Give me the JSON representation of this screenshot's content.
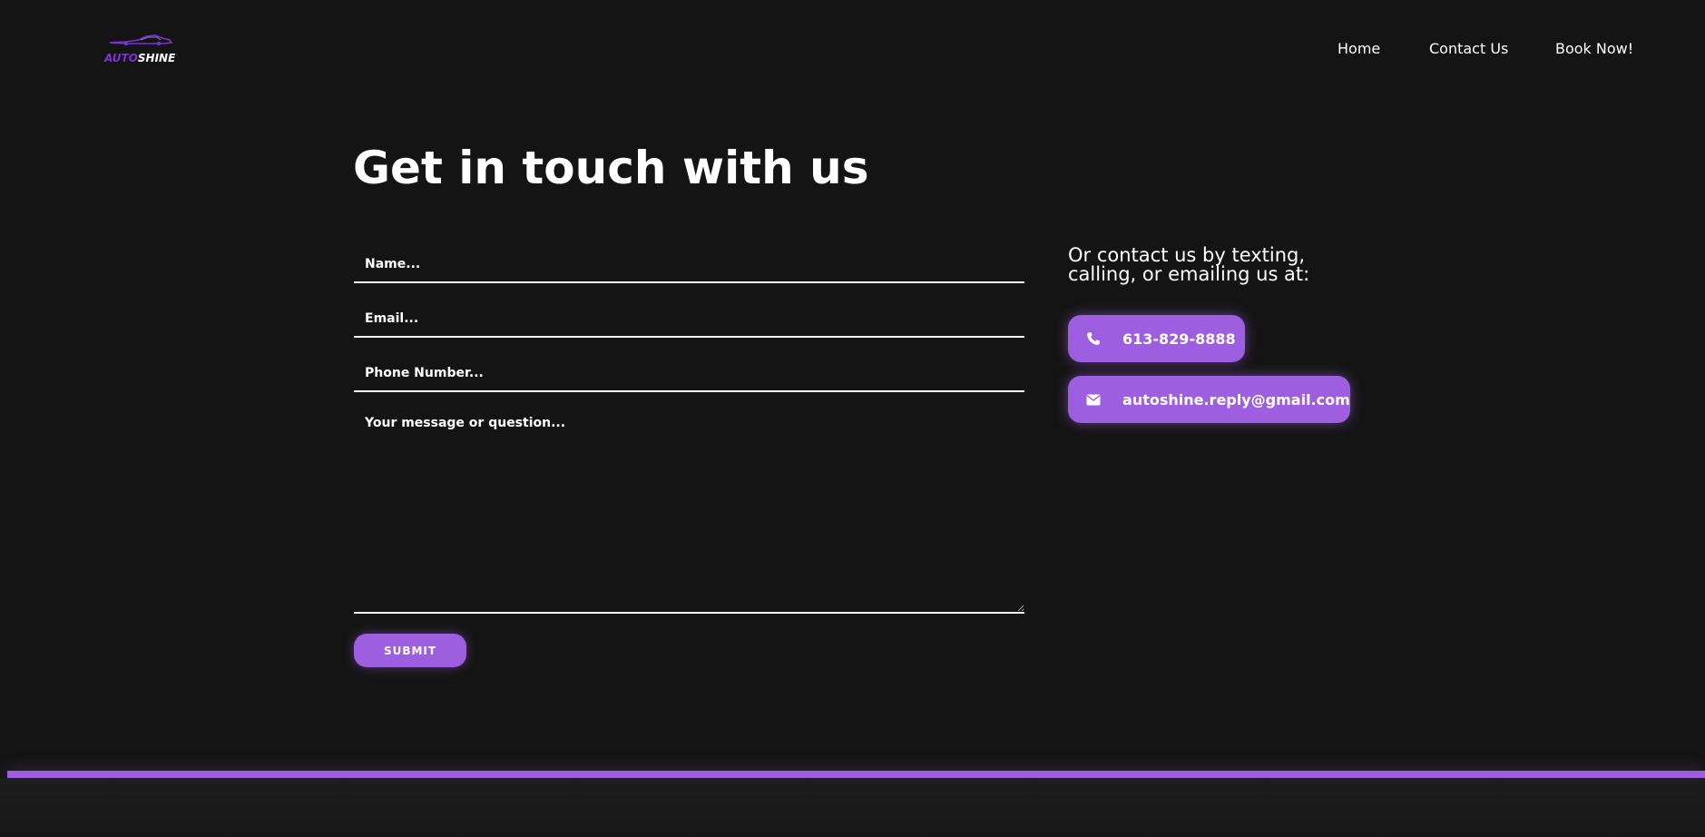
{
  "brand": {
    "part1": "AUTO",
    "part2": "SHINE",
    "accent_color": "#7a32d6"
  },
  "nav": {
    "items": [
      "Home",
      "Contact Us",
      "Book Now!"
    ]
  },
  "main": {
    "title": "Get in touch with us",
    "form": {
      "name_placeholder": "Name...",
      "email_placeholder": "Email...",
      "phone_placeholder": "Phone Number...",
      "message_placeholder": "Your message or question...",
      "submit_label": "SUBMIT"
    },
    "contact": {
      "heading": "Or contact us by texting, calling, or emailing us at:",
      "phone": "613-829-8888",
      "phone_icon": "phone-icon",
      "email": "autoshine.reply@gmail.com",
      "email_icon": "envelope-icon"
    }
  },
  "colors": {
    "background": "#141414",
    "accent": "#9d5ee0",
    "text": "#ffffff"
  }
}
